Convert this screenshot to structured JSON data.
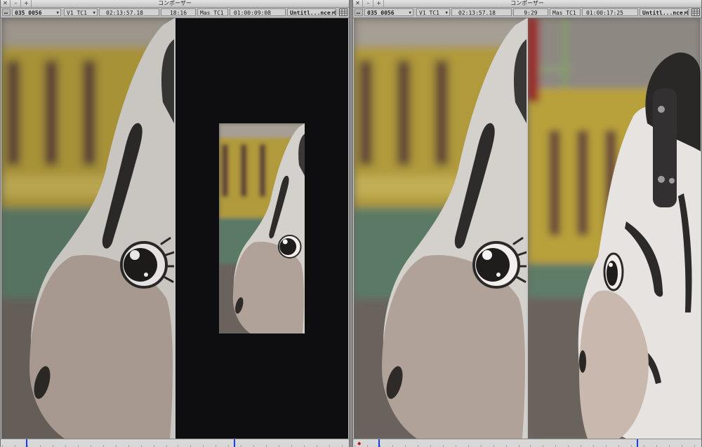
{
  "windows": [
    {
      "title": "コンポーザー",
      "buttons": [
        "✕",
        "–",
        "+"
      ],
      "source_clip": "035_0056",
      "source_track": "V1 TC1",
      "source_tc": "02:13:57.18",
      "duration": "18:16",
      "record_track": "Mas TC1",
      "record_tc": "01:00:09:08",
      "sequence": "Untitl...nce.02"
    },
    {
      "title": "コンポーザー",
      "buttons": [
        "✕",
        "–",
        "+"
      ],
      "source_clip": "035_0056",
      "source_track": "V1 TC1",
      "source_tc": "02:13:57.18",
      "duration": "9:29",
      "record_track": "Mas TC1",
      "record_tc": "01:00:17:25",
      "sequence": "Untitl...nce.02"
    }
  ],
  "colors": {
    "chrome": "#c8c8c8",
    "playhead": "#1a3cff",
    "black_frame": "#0e0e10"
  },
  "icons": [
    "close-icon",
    "minimize-icon",
    "zoom-icon",
    "dropdown-arrow-icon",
    "grid-menu-icon",
    "zebra-toy-image"
  ]
}
